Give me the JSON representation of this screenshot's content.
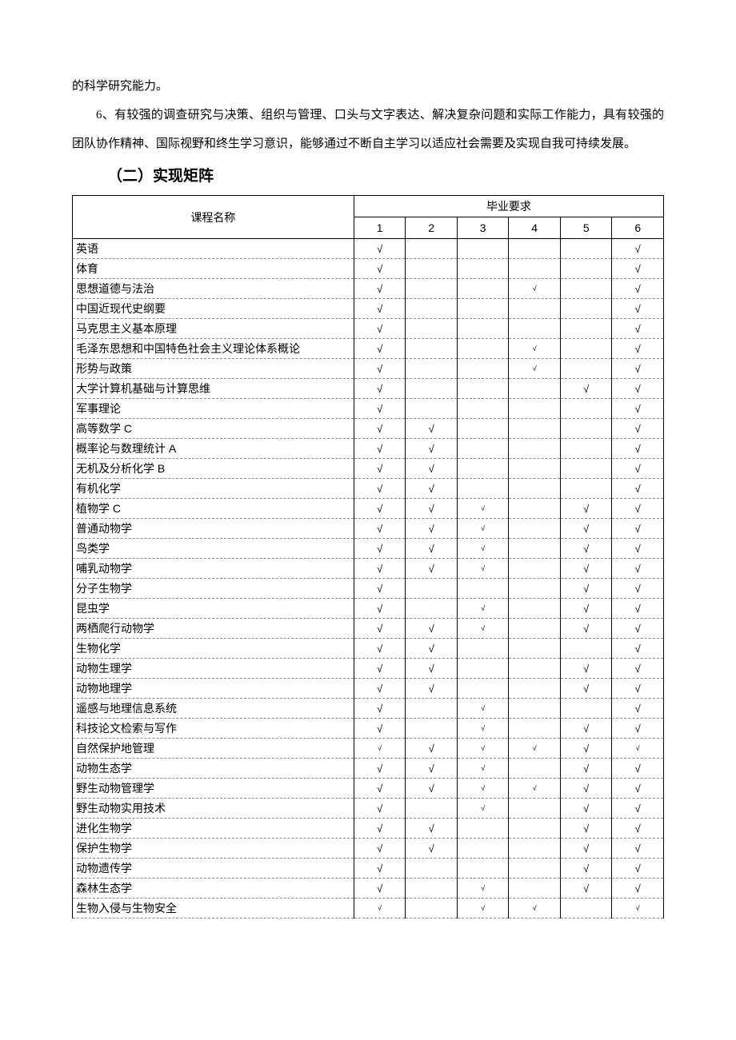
{
  "paragraphs": {
    "p1": "的科学研究能力。",
    "p2": "6、有较强的调查研究与决策、组织与管理、口头与文字表达、解决复杂问题和实际工作能力，具有较强的团队协作精神、国际视野和终生学习意识，能够通过不断自主学习以适应社会需要及实现自我可持续发展。"
  },
  "section_heading": "（二）实现矩阵",
  "table": {
    "header_course": "课程名称",
    "header_group": "毕业要求",
    "req_labels": [
      "1",
      "2",
      "3",
      "4",
      "5",
      "6"
    ],
    "tick": "√",
    "rows": [
      {
        "name": "英语",
        "marks": [
          1,
          0,
          0,
          0,
          0,
          1
        ],
        "small": [
          0,
          0,
          0,
          0,
          0,
          0
        ]
      },
      {
        "name": "体育",
        "marks": [
          1,
          0,
          0,
          0,
          0,
          1
        ],
        "small": [
          0,
          0,
          0,
          0,
          0,
          0
        ]
      },
      {
        "name": "思想道德与法治",
        "marks": [
          1,
          0,
          0,
          1,
          0,
          1
        ],
        "small": [
          0,
          0,
          0,
          1,
          0,
          0
        ]
      },
      {
        "name": "中国近现代史纲要",
        "marks": [
          1,
          0,
          0,
          0,
          0,
          1
        ],
        "small": [
          0,
          0,
          0,
          0,
          0,
          0
        ]
      },
      {
        "name": "马克思主义基本原理",
        "marks": [
          1,
          0,
          0,
          0,
          0,
          1
        ],
        "small": [
          0,
          0,
          0,
          0,
          0,
          0
        ]
      },
      {
        "name": "毛泽东思想和中国特色社会主义理论体系概论",
        "marks": [
          1,
          0,
          0,
          1,
          0,
          1
        ],
        "small": [
          0,
          0,
          0,
          1,
          0,
          0
        ]
      },
      {
        "name": "形势与政策",
        "marks": [
          1,
          0,
          0,
          1,
          0,
          1
        ],
        "small": [
          0,
          0,
          0,
          1,
          0,
          0
        ]
      },
      {
        "name": "大学计算机基础与计算思维",
        "marks": [
          1,
          0,
          0,
          0,
          1,
          1
        ],
        "small": [
          0,
          0,
          0,
          0,
          0,
          0
        ]
      },
      {
        "name": "军事理论",
        "marks": [
          1,
          0,
          0,
          0,
          0,
          1
        ],
        "small": [
          0,
          0,
          0,
          0,
          0,
          0
        ]
      },
      {
        "name": "高等数学 C",
        "marks": [
          1,
          1,
          0,
          0,
          0,
          1
        ],
        "small": [
          0,
          0,
          0,
          0,
          0,
          0
        ]
      },
      {
        "name": "概率论与数理统计 A",
        "marks": [
          1,
          1,
          0,
          0,
          0,
          1
        ],
        "small": [
          0,
          0,
          0,
          0,
          0,
          0
        ]
      },
      {
        "name": "无机及分析化学 B",
        "marks": [
          1,
          1,
          0,
          0,
          0,
          1
        ],
        "small": [
          0,
          0,
          0,
          0,
          0,
          0
        ]
      },
      {
        "name": "有机化学",
        "marks": [
          1,
          1,
          0,
          0,
          0,
          1
        ],
        "small": [
          0,
          0,
          0,
          0,
          0,
          0
        ]
      },
      {
        "name": "植物学 C",
        "marks": [
          1,
          1,
          1,
          0,
          1,
          1
        ],
        "small": [
          0,
          0,
          1,
          0,
          0,
          0
        ]
      },
      {
        "name": "普通动物学",
        "marks": [
          1,
          1,
          1,
          0,
          1,
          1
        ],
        "small": [
          0,
          0,
          1,
          0,
          0,
          0
        ]
      },
      {
        "name": "鸟类学",
        "marks": [
          1,
          1,
          1,
          0,
          1,
          1
        ],
        "small": [
          0,
          0,
          1,
          0,
          0,
          0
        ]
      },
      {
        "name": "哺乳动物学",
        "marks": [
          1,
          1,
          1,
          0,
          1,
          1
        ],
        "small": [
          0,
          0,
          1,
          0,
          0,
          0
        ]
      },
      {
        "name": "分子生物学",
        "marks": [
          1,
          0,
          0,
          0,
          1,
          1
        ],
        "small": [
          0,
          0,
          0,
          0,
          0,
          0
        ]
      },
      {
        "name": "昆虫学",
        "marks": [
          1,
          0,
          1,
          0,
          1,
          1
        ],
        "small": [
          0,
          0,
          1,
          0,
          0,
          0
        ]
      },
      {
        "name": "两栖爬行动物学",
        "marks": [
          1,
          1,
          1,
          0,
          1,
          1
        ],
        "small": [
          0,
          0,
          1,
          0,
          0,
          0
        ]
      },
      {
        "name": "生物化学",
        "marks": [
          1,
          1,
          0,
          0,
          0,
          1
        ],
        "small": [
          0,
          0,
          0,
          0,
          0,
          0
        ]
      },
      {
        "name": "动物生理学",
        "marks": [
          1,
          1,
          0,
          0,
          1,
          1
        ],
        "small": [
          0,
          0,
          0,
          0,
          0,
          0
        ]
      },
      {
        "name": "动物地理学",
        "marks": [
          1,
          1,
          0,
          0,
          1,
          1
        ],
        "small": [
          0,
          0,
          0,
          0,
          0,
          0
        ]
      },
      {
        "name": "遥感与地理信息系统",
        "marks": [
          1,
          0,
          1,
          0,
          0,
          1
        ],
        "small": [
          0,
          0,
          1,
          0,
          0,
          0
        ]
      },
      {
        "name": "科技论文检索与写作",
        "marks": [
          1,
          0,
          1,
          0,
          1,
          1
        ],
        "small": [
          0,
          0,
          1,
          0,
          0,
          0
        ]
      },
      {
        "name": "自然保护地管理",
        "marks": [
          1,
          1,
          1,
          1,
          1,
          1
        ],
        "small": [
          1,
          0,
          1,
          1,
          0,
          1
        ]
      },
      {
        "name": "动物生态学",
        "marks": [
          1,
          1,
          1,
          0,
          1,
          1
        ],
        "small": [
          0,
          0,
          1,
          0,
          0,
          0
        ]
      },
      {
        "name": "野生动物管理学",
        "marks": [
          1,
          1,
          1,
          1,
          1,
          1
        ],
        "small": [
          0,
          0,
          1,
          1,
          0,
          0
        ]
      },
      {
        "name": "野生动物实用技术",
        "marks": [
          1,
          0,
          1,
          0,
          1,
          1
        ],
        "small": [
          0,
          0,
          1,
          0,
          0,
          0
        ]
      },
      {
        "name": "进化生物学",
        "marks": [
          1,
          1,
          0,
          0,
          1,
          1
        ],
        "small": [
          0,
          0,
          0,
          0,
          0,
          0
        ]
      },
      {
        "name": "保护生物学",
        "marks": [
          1,
          1,
          0,
          0,
          1,
          1
        ],
        "small": [
          0,
          0,
          0,
          0,
          0,
          0
        ]
      },
      {
        "name": "动物遗传学",
        "marks": [
          1,
          0,
          0,
          0,
          1,
          1
        ],
        "small": [
          0,
          0,
          0,
          0,
          0,
          0
        ]
      },
      {
        "name": "森林生态学",
        "marks": [
          1,
          0,
          1,
          0,
          1,
          1
        ],
        "small": [
          0,
          0,
          1,
          0,
          0,
          0
        ]
      },
      {
        "name": "生物入侵与生物安全",
        "marks": [
          1,
          0,
          1,
          1,
          0,
          1
        ],
        "small": [
          1,
          0,
          1,
          1,
          0,
          1
        ]
      }
    ]
  }
}
